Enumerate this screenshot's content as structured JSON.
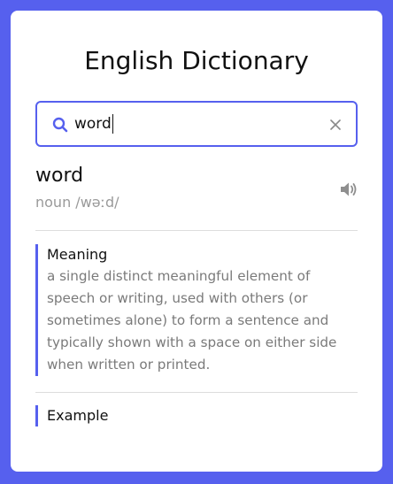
{
  "app": {
    "title": "English Dictionary"
  },
  "search": {
    "value": "word",
    "clear_icon": "close-icon",
    "search_icon": "search-icon"
  },
  "result": {
    "word": "word",
    "phonetic": "noun /wəːd/",
    "speaker_icon": "speaker-icon"
  },
  "meaning": {
    "title": "Meaning",
    "text": "a single distinct meaningful element of speech or writing, used with others (or sometimes alone) to form a sentence and typically shown with a space on either side when written or printed."
  },
  "example": {
    "title": "Example"
  },
  "colors": {
    "accent": "#5660EE",
    "background": "#5660EE",
    "card": "#FFFFFF",
    "muted": "#9A9A9A"
  }
}
